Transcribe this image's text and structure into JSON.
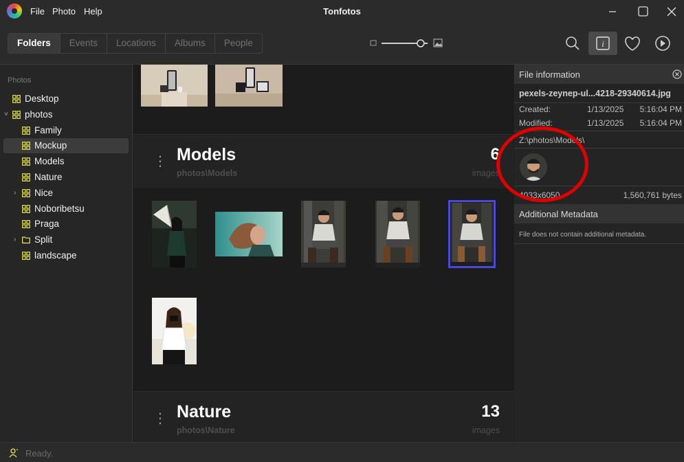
{
  "app": {
    "title": "Tonfotos"
  },
  "menu": {
    "file": "File",
    "photo": "Photo",
    "help": "Help"
  },
  "toolbar": {
    "tabs": [
      "Folders",
      "Events",
      "Locations",
      "Albums",
      "People"
    ],
    "active_tab": "Folders",
    "zoom_level": 0.85
  },
  "sidebar": {
    "header": "Photos",
    "items": [
      {
        "label": "Desktop",
        "depth": 0,
        "expander": ""
      },
      {
        "label": "photos",
        "depth": 0,
        "expander": "˅"
      },
      {
        "label": "Family",
        "depth": 1,
        "expander": ""
      },
      {
        "label": "Mockup",
        "depth": 1,
        "expander": "",
        "selected": true
      },
      {
        "label": "Models",
        "depth": 1,
        "expander": ""
      },
      {
        "label": "Nature",
        "depth": 1,
        "expander": ""
      },
      {
        "label": "Nice",
        "depth": 1,
        "expander": "›"
      },
      {
        "label": "Noboribetsu",
        "depth": 1,
        "expander": ""
      },
      {
        "label": "Praga",
        "depth": 1,
        "expander": ""
      },
      {
        "label": "Split",
        "depth": 1,
        "expander": "›",
        "plain_folder": true
      },
      {
        "label": "landscape",
        "depth": 1,
        "expander": ""
      }
    ]
  },
  "sections": {
    "models": {
      "title": "Models",
      "path": "photos\\Models",
      "count": "6",
      "unit": "images"
    },
    "nature": {
      "title": "Nature",
      "path": "photos\\Nature",
      "count": "13",
      "unit": "images"
    }
  },
  "file_info": {
    "header": "File information",
    "filename": "pexels-zeynep-ul...4218-29340614.jpg",
    "created_label": "Created:",
    "created_date": "1/13/2025",
    "created_time": "5:16:04 PM",
    "modified_label": "Modified:",
    "modified_date": "1/13/2025",
    "modified_time": "5:16:04 PM",
    "path": "Z:\\photos\\Models\\",
    "dimensions": "4033x6050",
    "size": "1,560,761 bytes",
    "additional_header": "Additional Metadata",
    "additional_text": "File does not contain additional metadata."
  },
  "status": {
    "text": "Ready."
  },
  "colors": {
    "accent_selection": "#4a4ad8",
    "annotation": "#e00000",
    "folder_icon": "#e8e84a"
  }
}
